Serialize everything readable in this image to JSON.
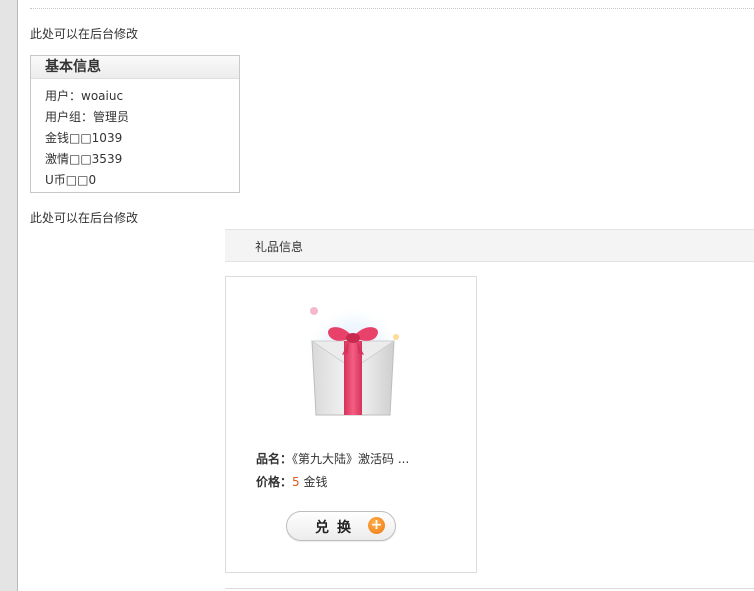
{
  "notes": {
    "top": "此处可以在后台修改",
    "middle": "此处可以在后台修改"
  },
  "basic_info": {
    "title": "基本信息",
    "rows": [
      "用户：woaiuc",
      "用户组：管理员",
      "金钱□□1039",
      "激情□□3539",
      "U币□□0"
    ]
  },
  "gift_section": {
    "title": "礼品信息"
  },
  "gift": {
    "name_label": "品名：",
    "name_value": "《第九大陆》激活码 ...",
    "price_label": "价格：",
    "price_value": "5",
    "price_unit": " 金钱",
    "button_label": "兑换",
    "button_icon": "+"
  },
  "colors": {
    "price": "#e05a1e",
    "ribbon": "#e8416a",
    "button_plus": "#ee7812"
  }
}
